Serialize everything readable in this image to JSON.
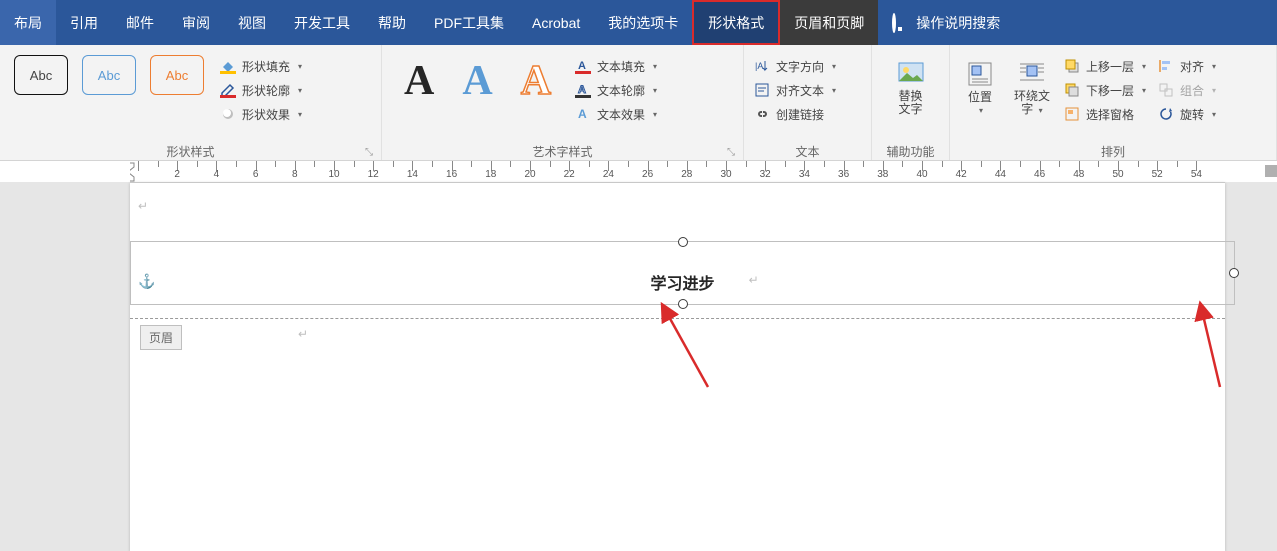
{
  "tabs": {
    "t0": "布局",
    "t1": "引用",
    "t2": "邮件",
    "t3": "审阅",
    "t4": "视图",
    "t5": "开发工具",
    "t6": "帮助",
    "t7": "PDF工具集",
    "t8": "Acrobat",
    "t9": "我的选项卡",
    "t10": "形状格式",
    "t11": "页眉和页脚"
  },
  "search": "操作说明搜索",
  "groups": {
    "g0": "形状样式",
    "g1": "艺术字样式",
    "g2": "文本",
    "g3": "辅助功能",
    "g4": "排列"
  },
  "shapeStyle": {
    "abc": "Abc",
    "fill": "形状填充",
    "outline": "形状轮廓",
    "effects": "形状效果"
  },
  "wordart": {
    "fill": "文本填充",
    "outline": "文本轮廓",
    "effects": "文本效果"
  },
  "text": {
    "dir": "文字方向",
    "align": "对齐文本",
    "link": "创建链接"
  },
  "alt": {
    "l1": "替换",
    "l2": "文字"
  },
  "arrange": {
    "pos": "位置",
    "wrap_l1": "环绕文",
    "wrap_l2": "字",
    "up": "上移一层",
    "down": "下移一层",
    "pane": "选择窗格",
    "align": "对齐",
    "group": "组合",
    "rotate": "旋转"
  },
  "ruler": [
    " ",
    " ",
    "2",
    " ",
    "4",
    " ",
    "6",
    " ",
    "8",
    " ",
    "10",
    " ",
    "12",
    " ",
    "14",
    " ",
    "16",
    " ",
    "18",
    " ",
    "20",
    " ",
    "22",
    " ",
    "24",
    " ",
    "26",
    " ",
    "28",
    " ",
    "30",
    " ",
    "32",
    " ",
    "34",
    " ",
    "36",
    " ",
    "38",
    " ",
    "40",
    " ",
    "42",
    " ",
    "44",
    " ",
    "46",
    " ",
    "48",
    " ",
    "50",
    " ",
    "52",
    " ",
    "54"
  ],
  "doc": {
    "title": "学习进步",
    "hdr": "页眉"
  }
}
